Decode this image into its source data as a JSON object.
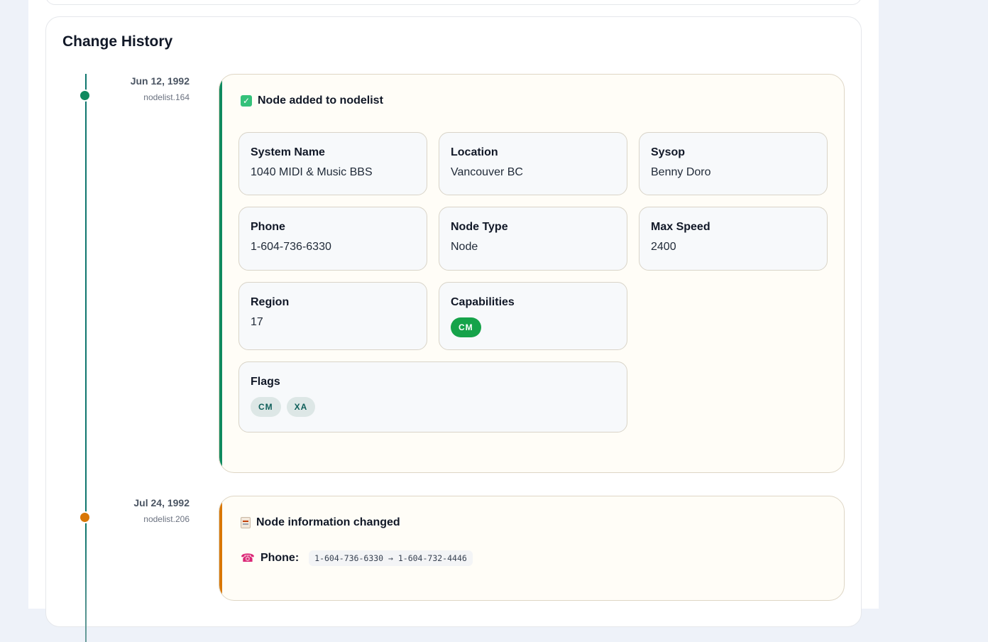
{
  "history": {
    "title": "Change History",
    "entries": [
      {
        "date": "Jun 12, 1992",
        "source": "nodelist.164",
        "heading": "Node added to nodelist",
        "fields": {
          "system_name": {
            "label": "System Name",
            "value": "1040 MIDI & Music BBS"
          },
          "location": {
            "label": "Location",
            "value": "Vancouver BC"
          },
          "sysop": {
            "label": "Sysop",
            "value": "Benny Doro"
          },
          "phone": {
            "label": "Phone",
            "value": "1-604-736-6330"
          },
          "node_type": {
            "label": "Node Type",
            "value": "Node"
          },
          "max_speed": {
            "label": "Max Speed",
            "value": "2400"
          },
          "region": {
            "label": "Region",
            "value": "17"
          },
          "capabilities": {
            "label": "Capabilities",
            "items": [
              "CM"
            ]
          },
          "flags": {
            "label": "Flags",
            "items": [
              "CM",
              "XA"
            ]
          }
        }
      },
      {
        "date": "Jul 24, 1992",
        "source": "nodelist.206",
        "heading": "Node information changed",
        "change": {
          "label": "Phone:",
          "value": "1-604-736-6330 → 1-604-732-4446"
        }
      }
    ]
  }
}
